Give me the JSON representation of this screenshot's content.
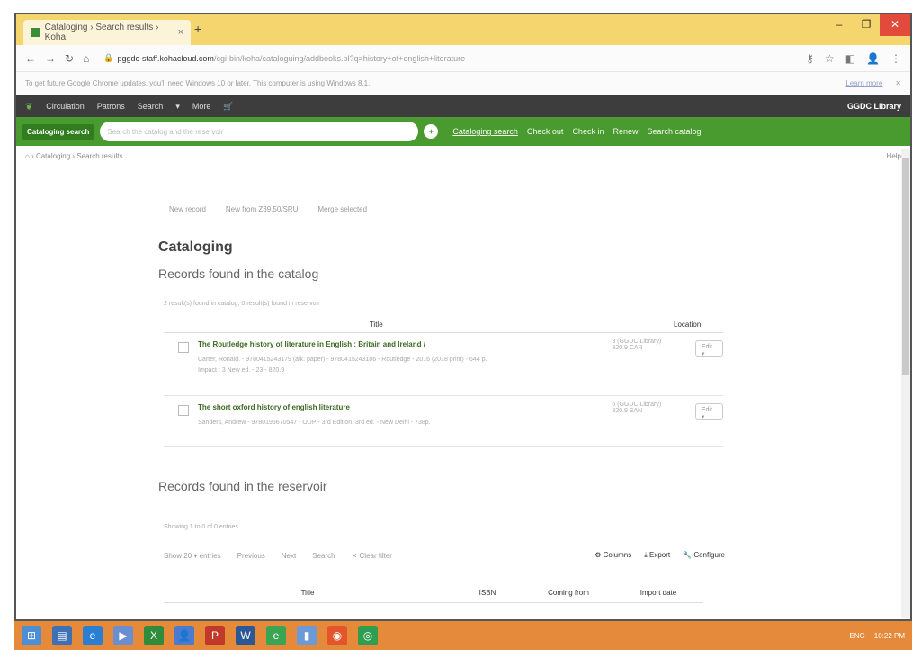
{
  "browser": {
    "tab_title": "Cataloging › Search results › Koha",
    "url_host": "pggdc-staff.kohacloud.com",
    "url_path": "/cgi-bin/koha/cataloguing/addbooks.pl?q=history+of+english+literature",
    "info_text": "To get future Google Chrome updates, you'll need Windows 10 or later. This computer is using Windows 8.1.",
    "learn_more": "Learn more"
  },
  "nav": {
    "items": [
      "Circulation",
      "Patrons",
      "Search",
      "More",
      "Cart"
    ],
    "library": "GGDC Library"
  },
  "search": {
    "category": "Cataloging search",
    "placeholder": "Search the catalog and the reservoir",
    "links": [
      "Cataloging search",
      "Check out",
      "Check in",
      "Renew",
      "Search catalog"
    ]
  },
  "breadcrumb": {
    "home": "Cataloging",
    "current": "Search results",
    "help": "Help"
  },
  "toolbar": {
    "new_record": "New record",
    "new_z3950": "New from Z39.50/SRU",
    "merge": "Merge selected"
  },
  "page": {
    "title": "Cataloging",
    "catalog_heading": "Records found in the catalog",
    "found_text": "2 result(s) found in catalog, 0 result(s) found in reservoir",
    "col_title": "Title",
    "col_location": "Location",
    "edit_label": "Edit"
  },
  "records": [
    {
      "title": "The Routledge history of literature in English : Britain and Ireland /",
      "meta": "Carter, Ronald. - 9780415243179 (alk. paper) - 9780415243186 - Routledge - 2016 (2018 print) - 644 p.",
      "meta2": "Impact : 3 New ed. - 23 - 820.9",
      "location": "3 (GGDC Library) 820.9 CAR"
    },
    {
      "title": "The short oxford history of english literature",
      "meta": "Sanders, Andrew - 9780195670547 - OUP - 3rd Edition. 3rd ed. - New Delhi - 738p.",
      "meta2": "",
      "location": "6 (GGDC Library) 820.9 SAN"
    }
  ],
  "reservoir": {
    "heading": "Records found in the reservoir",
    "info": "Showing 1 to 0 of 0 entries",
    "show": "Show",
    "show_val": "20",
    "entries": "entries",
    "previous": "Previous",
    "next": "Next",
    "search": "Search",
    "clear_filter": "Clear filter",
    "columns_btn": "Columns",
    "export_btn": "Export",
    "configure_btn": "Configure",
    "headers": [
      "Title",
      "ISBN",
      "Coming from",
      "Import date"
    ]
  },
  "taskbar": {
    "lang": "ENG",
    "time": "10:22 PM"
  },
  "colors": {
    "koha_green": "#4a9b2f",
    "nav_dark": "#3d3d3d",
    "taskbar": "#e58a3a",
    "tabbar": "#f5d66e"
  }
}
